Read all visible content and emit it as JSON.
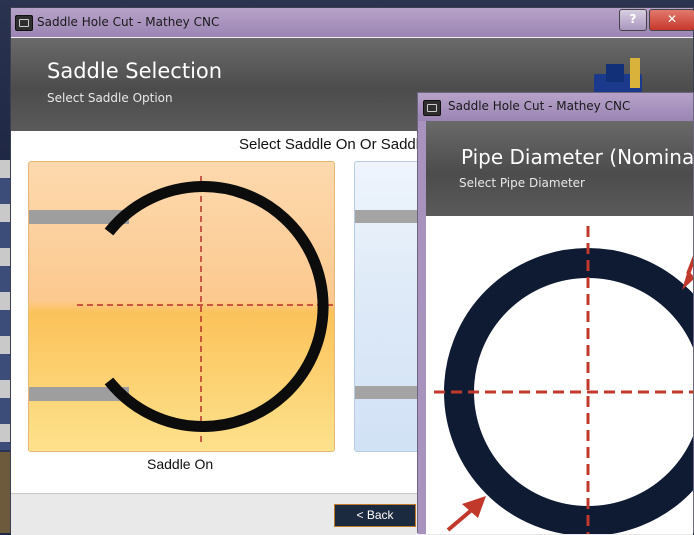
{
  "window1": {
    "title": "Saddle Hole Cut - Mathey CNC",
    "header_title": "Saddle Selection",
    "header_subtitle": "Select Saddle Option",
    "prompt": "Select Saddle On Or Saddle",
    "option1_label": "Saddle On",
    "back_button": "< Back",
    "help_button": "?",
    "close_button": "✕"
  },
  "window2": {
    "title": "Saddle Hole Cut - Mathey CNC",
    "header_title": "Pipe Diameter (Nominal",
    "header_subtitle": "Select Pipe Diameter"
  },
  "colors": {
    "titlebar": "#a892be",
    "header_gray": "#555555",
    "saddle_on_card": "#fdd9a8",
    "ring": "#0f1a33",
    "crosshair": "#c0392b",
    "close_red": "#c8372d",
    "button_dark": "#1c2a3f"
  }
}
